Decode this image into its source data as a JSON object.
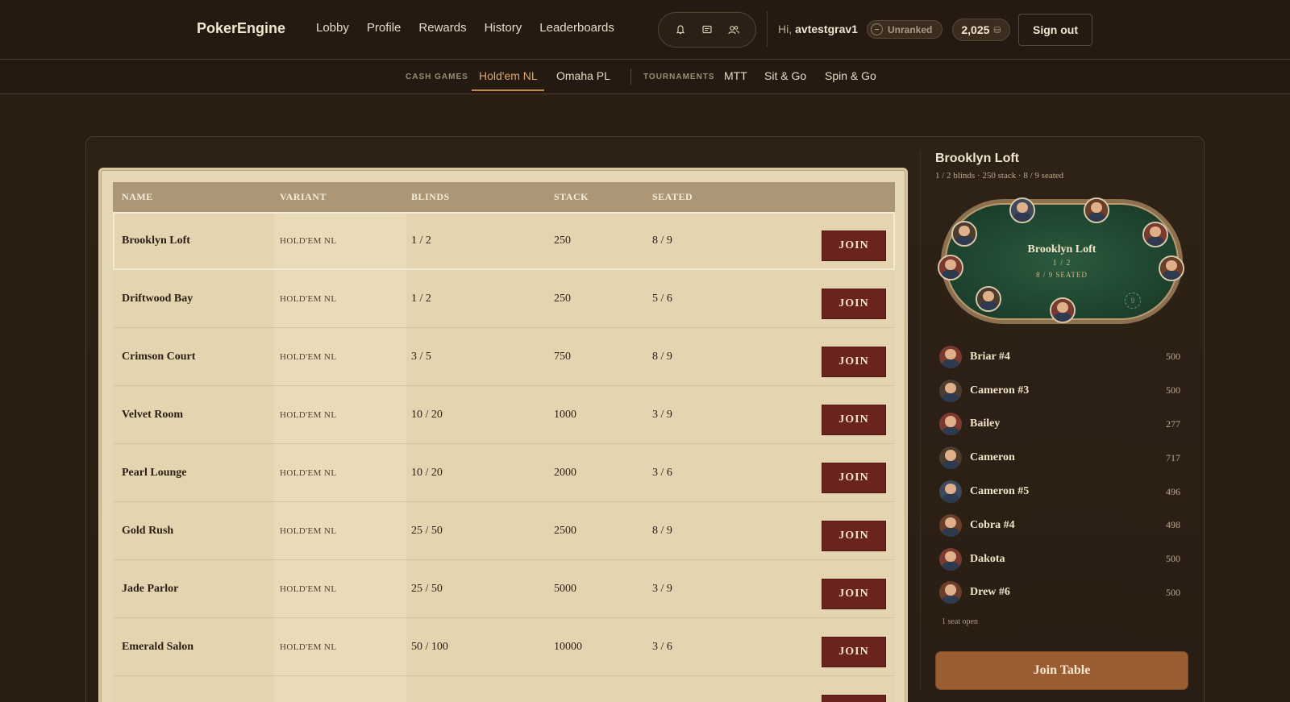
{
  "brand": "PokerEngine",
  "nav": [
    "Lobby",
    "Profile",
    "Rewards",
    "History",
    "Leaderboards"
  ],
  "icons": [
    "bell-icon",
    "chat-icon",
    "friends-icon"
  ],
  "user": {
    "greeting": "Hi,",
    "name": "avtestgrav1",
    "rank": "Unranked",
    "rank_symbol": "–",
    "coins": "2,025",
    "coin_symbol": "⛁",
    "signout_label": "Sign out"
  },
  "subnav": {
    "cash_label": "CASH GAMES",
    "cash_tabs": [
      "Hold'em NL",
      "Omaha PL"
    ],
    "active_tab": "Hold'em NL",
    "tournaments_label": "TOURNAMENTS",
    "tournament_tabs": [
      "MTT",
      "Sit & Go",
      "Spin & Go"
    ]
  },
  "table_list": {
    "headers": [
      "NAME",
      "VARIANT",
      "BLINDS",
      "STACK",
      "SEATED"
    ],
    "join_label": "JOIN",
    "rows": [
      {
        "name": "Brooklyn Loft",
        "variant": "HOLD'EM NL",
        "blinds": "1 / 2",
        "stack": "250",
        "seated": "8 / 9"
      },
      {
        "name": "Driftwood Bay",
        "variant": "HOLD'EM NL",
        "blinds": "1 / 2",
        "stack": "250",
        "seated": "5 / 6"
      },
      {
        "name": "Crimson Court",
        "variant": "HOLD'EM NL",
        "blinds": "3 / 5",
        "stack": "750",
        "seated": "8 / 9"
      },
      {
        "name": "Velvet Room",
        "variant": "HOLD'EM NL",
        "blinds": "10 / 20",
        "stack": "1000",
        "seated": "3 / 9"
      },
      {
        "name": "Pearl Lounge",
        "variant": "HOLD'EM NL",
        "blinds": "10 / 20",
        "stack": "2000",
        "seated": "3 / 6"
      },
      {
        "name": "Gold Rush",
        "variant": "HOLD'EM NL",
        "blinds": "25 / 50",
        "stack": "2500",
        "seated": "8 / 9"
      },
      {
        "name": "Jade Parlor",
        "variant": "HOLD'EM NL",
        "blinds": "25 / 50",
        "stack": "5000",
        "seated": "3 / 9"
      },
      {
        "name": "Emerald Salon",
        "variant": "HOLD'EM NL",
        "blinds": "50 / 100",
        "stack": "10000",
        "seated": "3 / 6"
      },
      {
        "name": "",
        "variant": "",
        "blinds": "",
        "stack": "",
        "seated": ""
      }
    ]
  },
  "detail": {
    "title": "Brooklyn Loft",
    "subtitle": "1 / 2 blinds · 250 stack · 8 / 9 seated",
    "felt_name": "Brooklyn Loft",
    "felt_blinds": "1 / 2",
    "felt_seated": "8 / 9 SEATED",
    "empty_seat_number": "9",
    "players": [
      {
        "name": "Briar #4",
        "stack": "500"
      },
      {
        "name": "Cameron #3",
        "stack": "500"
      },
      {
        "name": "Bailey",
        "stack": "277"
      },
      {
        "name": "Cameron",
        "stack": "717"
      },
      {
        "name": "Cameron #5",
        "stack": "496"
      },
      {
        "name": "Cobra #4",
        "stack": "498"
      },
      {
        "name": "Dakota",
        "stack": "500"
      },
      {
        "name": "Drew #6",
        "stack": "500"
      }
    ],
    "seat_open": "1 seat open",
    "join_table_label": "Join Table"
  }
}
